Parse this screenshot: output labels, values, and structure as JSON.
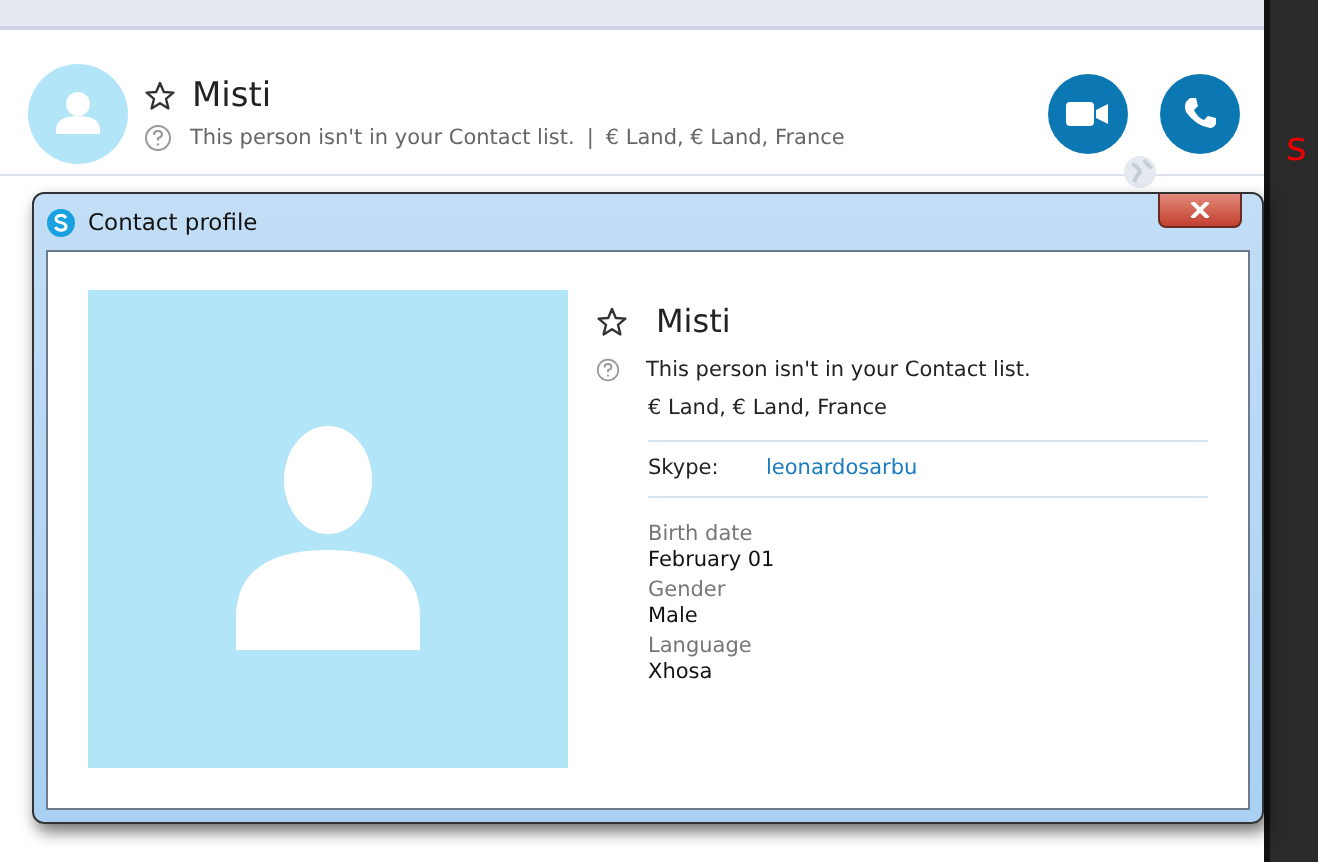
{
  "header": {
    "name": "Misti",
    "favorite": false,
    "status": "This person isn't in your Contact list.",
    "separator": "|",
    "location": "€ Land, € Land, France"
  },
  "edge_text": "s",
  "dialog": {
    "title": "Contact profile",
    "name": "Misti",
    "favorite": false,
    "status": "This person isn't in your Contact list.",
    "location": "€ Land, € Land, France",
    "skype": {
      "label": "Skype:",
      "value": "leonardosarbu"
    },
    "fields": [
      {
        "label": "Birth date",
        "value": "February 01"
      },
      {
        "label": "Gender",
        "value": "Male"
      },
      {
        "label": "Language",
        "value": "Xhosa"
      }
    ]
  }
}
